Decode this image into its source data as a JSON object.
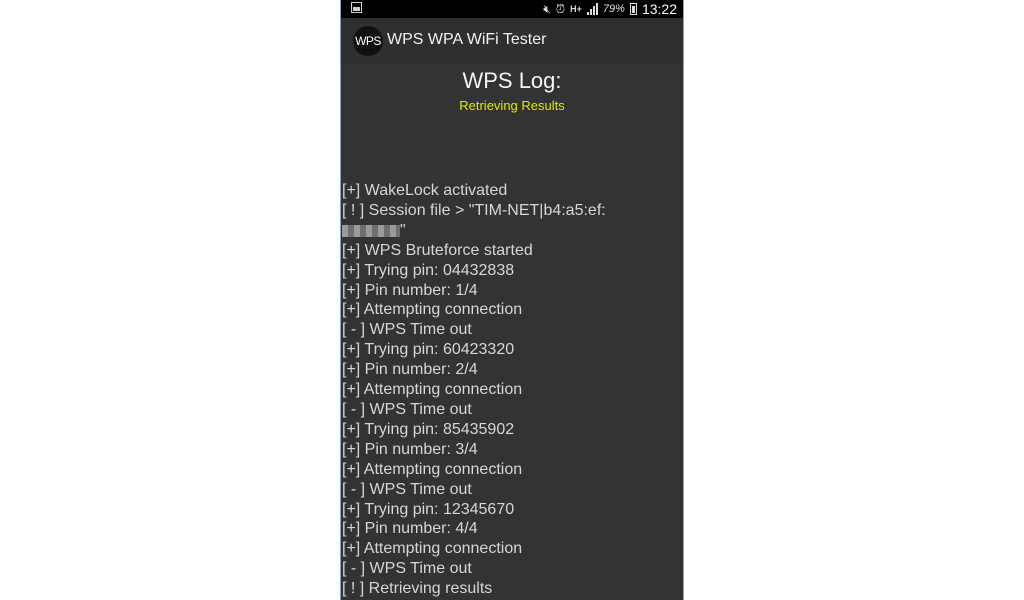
{
  "status_bar": {
    "icons": [
      "screenshot-icon",
      "mute-icon",
      "alarm-icon",
      "h-plus-icon",
      "signal-icon",
      "battery-icon"
    ],
    "network": "H+",
    "battery_percent": "79%",
    "time": "13:22"
  },
  "app_bar": {
    "logo_text": "WPS",
    "title": "WPS WPA WiFi Tester"
  },
  "log": {
    "title": "WPS Log:",
    "status": "Retrieving Results",
    "status_color": "#e6e600",
    "session_line_1": "[ ! ] Session file > \"TIM-NET|b4:a5:ef:",
    "session_line_2_suffix": "\"",
    "lines_before_session": [
      "[+] WakeLock activated"
    ],
    "lines_after_session": [
      "[+] WPS Bruteforce started",
      "[+] Trying pin: 04432838",
      "[+] Pin number: 1/4",
      "[+] Attempting connection",
      "[ - ] WPS Time out",
      "[+] Trying pin: 60423320",
      "[+] Pin number: 2/4",
      "[+] Attempting connection",
      "[ - ] WPS Time out",
      "[+] Trying pin: 85435902",
      "[+] Pin number: 3/4",
      "[+] Attempting connection",
      "[ - ] WPS Time out",
      "[+] Trying pin: 12345670",
      "[+] Pin number: 4/4",
      "[+] Attempting connection",
      "[ - ] WPS Time out",
      "[ ! ] Retrieving results"
    ]
  }
}
